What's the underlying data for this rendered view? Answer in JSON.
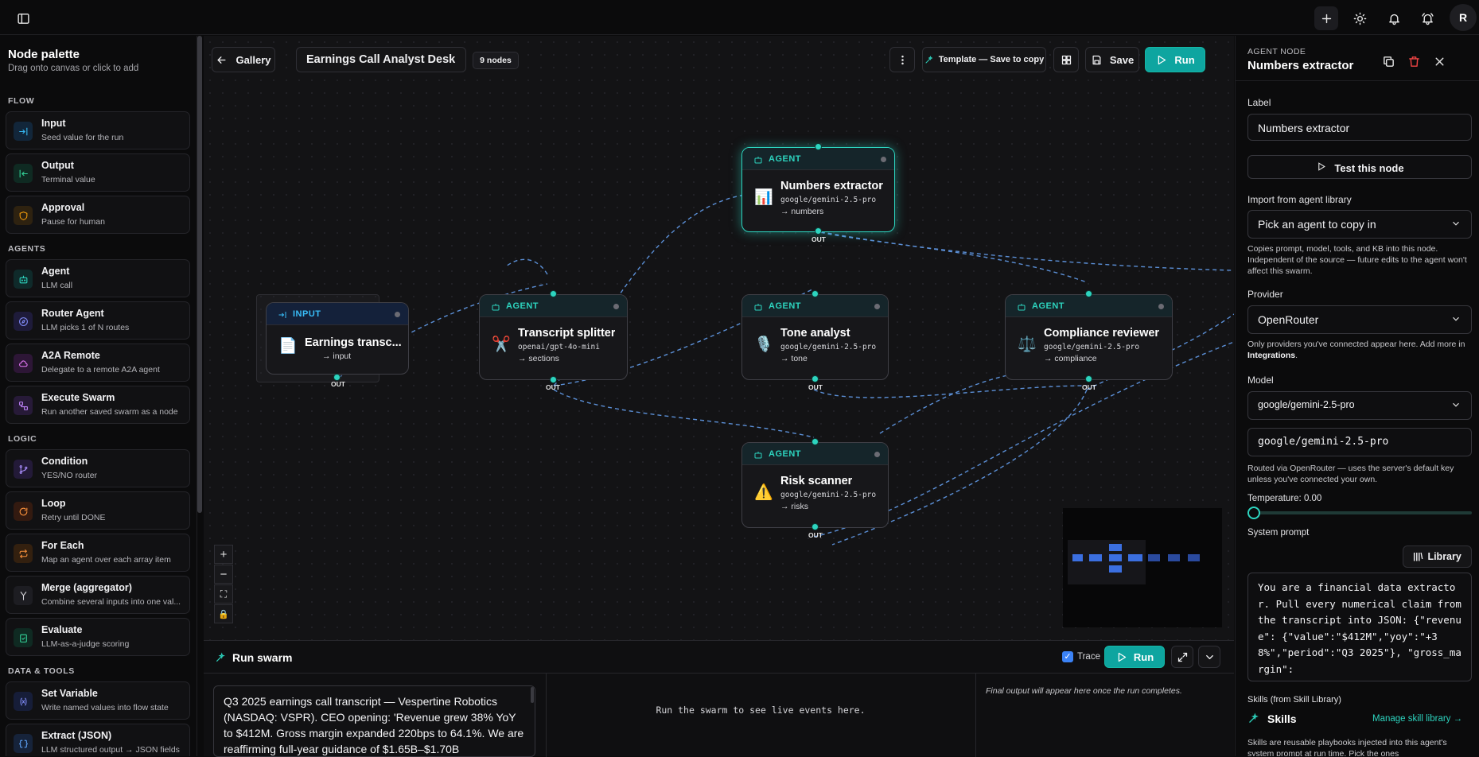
{
  "app": {
    "avatar": "R"
  },
  "palette": {
    "title": "Node palette",
    "subtitle": "Drag onto canvas or click to add",
    "sections": {
      "flow": "FLOW",
      "agents": "AGENTS",
      "logic": "LOGIC",
      "data": "DATA & TOOLS"
    },
    "items": [
      {
        "label": "Input",
        "desc": "Seed value for the run"
      },
      {
        "label": "Output",
        "desc": "Terminal value"
      },
      {
        "label": "Approval",
        "desc": "Pause for human"
      },
      {
        "label": "Agent",
        "desc": "LLM call"
      },
      {
        "label": "Router Agent",
        "desc": "LLM picks 1 of N routes"
      },
      {
        "label": "A2A Remote",
        "desc": "Delegate to a remote A2A agent"
      },
      {
        "label": "Execute Swarm",
        "desc": "Run another saved swarm as a node"
      },
      {
        "label": "Condition",
        "desc": "YES/NO router"
      },
      {
        "label": "Loop",
        "desc": "Retry until DONE"
      },
      {
        "label": "For Each",
        "desc": "Map an agent over each array item"
      },
      {
        "label": "Merge (aggregator)",
        "desc": "Combine several inputs into one val..."
      },
      {
        "label": "Evaluate",
        "desc": "LLM-as-a-judge scoring"
      },
      {
        "label": "Set Variable",
        "desc": "Write named values into flow state"
      },
      {
        "label": "Extract (JSON)",
        "desc": "LLM structured output → JSON fields"
      }
    ]
  },
  "toolbar": {
    "gallery": "Gallery",
    "swarm_name": "Earnings Call Analyst Desk",
    "node_count": "9 nodes",
    "template": "Template — Save to copy",
    "save": "Save",
    "run": "Run"
  },
  "nodes": {
    "input": {
      "type": "INPUT",
      "name": "Earnings transc...",
      "out": "→ input",
      "port": "OUT"
    },
    "splitter": {
      "type": "AGENT",
      "name": "Transcript splitter",
      "model": "openai/gpt-4o-mini",
      "out": "→ sections",
      "port": "OUT"
    },
    "numbers": {
      "type": "AGENT",
      "name": "Numbers extractor",
      "model": "google/gemini-2.5-pro",
      "out": "→ numbers",
      "port": "OUT"
    },
    "tone": {
      "type": "AGENT",
      "name": "Tone analyst",
      "model": "google/gemini-2.5-pro",
      "out": "→ tone",
      "port": "OUT"
    },
    "compliance": {
      "type": "AGENT",
      "name": "Compliance reviewer",
      "model": "google/gemini-2.5-pro",
      "out": "→ compliance",
      "port": "OUT"
    },
    "risk": {
      "type": "AGENT",
      "name": "Risk scanner",
      "model": "google/gemini-2.5-pro",
      "out": "→ risks",
      "port": "OUT"
    }
  },
  "run": {
    "title": "Run swarm",
    "trace": "Trace",
    "run": "Run",
    "prompt": "Q3 2025 earnings call transcript — Vespertine Robotics (NASDAQ: VSPR). CEO opening: 'Revenue grew 38% YoY to $412M. Gross margin expanded 220bps to 64.1%. We are reaffirming full-year guidance of $1.65B–$1.70B",
    "events_placeholder": "Run the swarm to see live events here.",
    "output_placeholder": "Final output will appear here once the run completes."
  },
  "inspector": {
    "kind": "AGENT NODE",
    "title": "Numbers extractor",
    "label_label": "Label",
    "label_value": "Numbers extractor",
    "test": "Test this node",
    "import_label": "Import from agent library",
    "import_placeholder": "Pick an agent to copy in",
    "import_help": "Copies prompt, model, tools, and KB into this node. Independent of the source — future edits to the agent won't affect this swarm.",
    "provider_label": "Provider",
    "provider_value": "OpenRouter",
    "provider_help_1": "Only providers you've connected appear here. Add more in ",
    "provider_help_link": "Integrations",
    "provider_help_2": ".",
    "model_label": "Model",
    "model_select": "google/gemini-2.5-pro",
    "model_input": "google/gemini-2.5-pro",
    "model_help": "Routed via OpenRouter — uses the server's default key unless you've connected your own.",
    "temperature": "Temperature: 0.00",
    "temperature_value": 0,
    "system_prompt_label": "System prompt",
    "library": "Library",
    "system_prompt": "You are a financial data extractor. Pull every numerical claim from the transcript into JSON: {\"revenue\": {\"value\":\"$412M\",\"yoy\":\"+38%\",\"period\":\"Q3 2025\"}, \"gross_margin\":",
    "skills_label": "Skills (from Skill Library)",
    "skills_title": "Skills",
    "manage": "Manage skill library →",
    "skills_help": "Skills are reusable playbooks injected into this agent's system prompt at run time. Pick the ones"
  }
}
